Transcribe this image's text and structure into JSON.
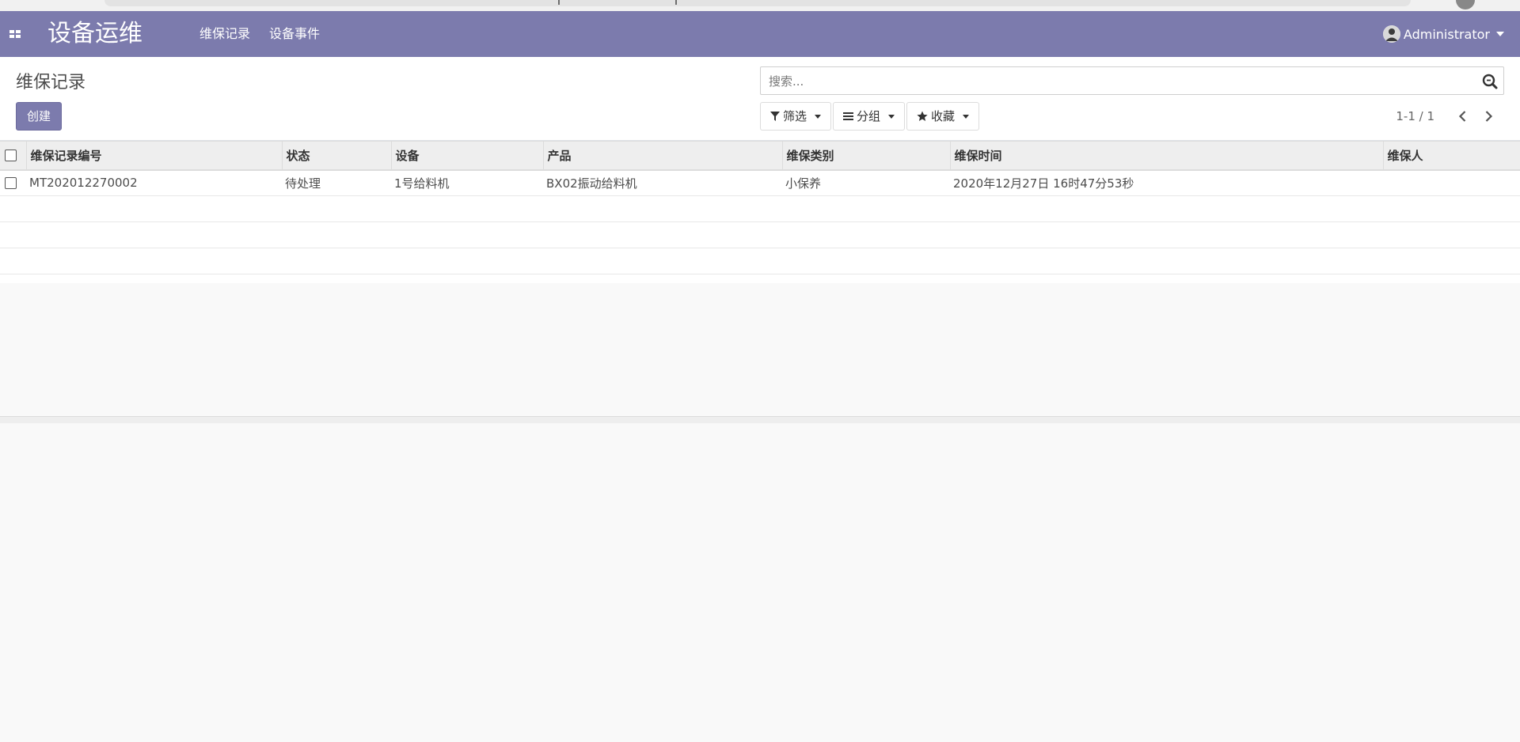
{
  "navbar": {
    "brand": "设备运维",
    "menu": [
      {
        "label": "维保记录"
      },
      {
        "label": "设备事件"
      }
    ],
    "user": "Administrator"
  },
  "control_panel": {
    "breadcrumb": "维保记录",
    "create_label": "创建",
    "search_placeholder": "搜索...",
    "filter_label": "筛选",
    "group_label": "分组",
    "favorites_label": "收藏",
    "pager": "1-1 / 1"
  },
  "list": {
    "columns": [
      "维保记录编号",
      "状态",
      "设备",
      "产品",
      "维保类别",
      "维保时间",
      "维保人"
    ],
    "rows": [
      [
        "MT202012270002",
        "待处理",
        "1号给料机",
        "BX02振动给料机",
        "小保养",
        "2020年12月27日 16时47分53秒",
        ""
      ]
    ]
  },
  "colors": {
    "navbar": "#7c7bad",
    "primary_button": "#7c7bad",
    "background": "#f9f9f9"
  }
}
